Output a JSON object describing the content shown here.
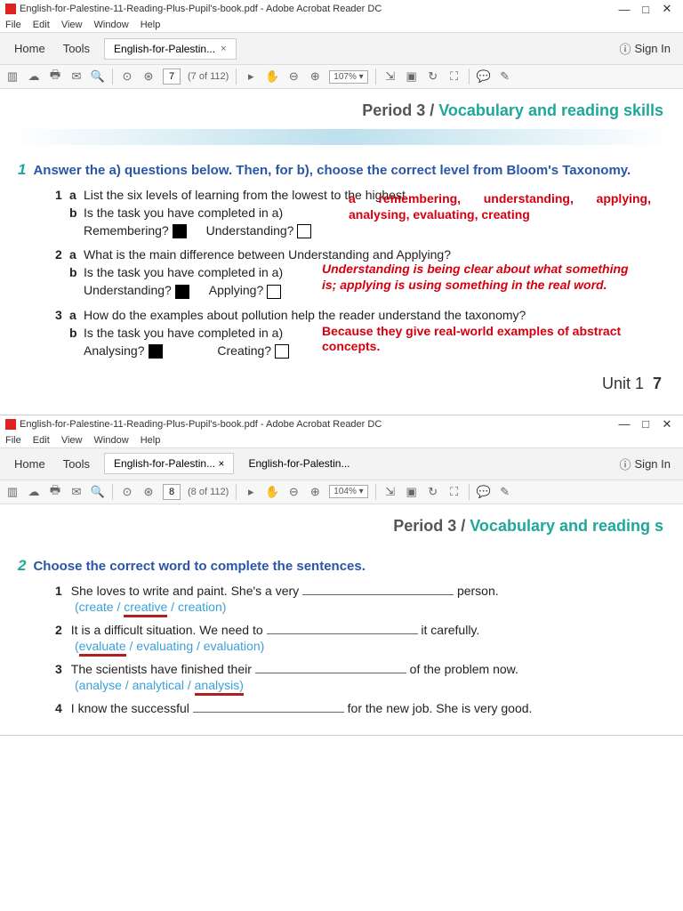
{
  "win1": {
    "title": "English-for-Palestine-11-Reading-Plus-Pupil's-book.pdf - Adobe Acrobat Reader DC",
    "menu": [
      "File",
      "Edit",
      "View",
      "Window",
      "Help"
    ],
    "tabs": {
      "home": "Home",
      "tools": "Tools",
      "doc": "English-for-Palestin...",
      "close": "×"
    },
    "signin": "Sign In",
    "page_val": "7",
    "page_of": "(7 of 112)",
    "zoom": "107% ▾"
  },
  "win2": {
    "title": "English-for-Palestine-11-Reading-Plus-Pupil's-book.pdf - Adobe Acrobat Reader DC",
    "menu": [
      "File",
      "Edit",
      "View",
      "Window",
      "Help"
    ],
    "tabs": {
      "home": "Home",
      "tools": "Tools",
      "doc1": "English-for-Palestin... ×",
      "doc2": "English-for-Palestin..."
    },
    "signin": "Sign In",
    "page_val": "8",
    "page_of": "(8 of 112)",
    "zoom": "104% ▾"
  },
  "heading": {
    "p3": "Period 3  /  ",
    "vrs": "Vocabulary and reading skills",
    "vrs2": "Vocabulary and reading s"
  },
  "ex1": {
    "num": "1",
    "instr": "Answer the a) questions below. Then, for b), choose the correct level from Bloom's Taxonomy.",
    "q1a": "List the six levels of learning from the lowest to the highest.",
    "q1b": "Is the task you have completed in a)",
    "q1b_opts": {
      "o1": "Remembering?",
      "o2": "Understanding?"
    },
    "q2a": "What is the main difference between Understanding and Applying?",
    "q2b": "Is the task you have completed in a)",
    "q2b_opts": {
      "o1": "Understanding?",
      "o2": "Applying?"
    },
    "q3a": "How do the examples about pollution help the reader understand the taxonomy?",
    "q3b": "Is the task you have completed in a)",
    "q3b_opts": {
      "o1": "Analysing?",
      "o2": "Creating?"
    },
    "ans1": "a remembering, understanding, applying, analysing, evaluating, creating",
    "ans2": "Understanding is being clear about what something is; applying is using something in the real word.",
    "ans3": "Because they give real-world examples of abstract concepts.",
    "unit": "Unit 1",
    "unitn": "7"
  },
  "ex2": {
    "num": "2",
    "instr": "Choose the correct word to complete the sentences.",
    "s1": {
      "n": "1",
      "t1": "She loves to write and paint. She's a very ",
      "t2": " person.",
      "opts_pre": "(create / ",
      "u": "creative",
      "opts_post": " / creation)"
    },
    "s2": {
      "n": "2",
      "t1": "It is a difficult situation. We need to ",
      "t2": " it carefully.",
      "opts_pre": "(",
      "u": "evaluate",
      "opts_post": " / evaluating / evaluation)"
    },
    "s3": {
      "n": "3",
      "t1": "The scientists have finished their ",
      "t2": " of the problem now.",
      "opts_pre": "(analyse / analytical / ",
      "u": "analysis)",
      "opts_post": ""
    },
    "s4": {
      "n": "4",
      "t1": "I know the successful ",
      "t2": " for the new job. She is very good."
    }
  }
}
